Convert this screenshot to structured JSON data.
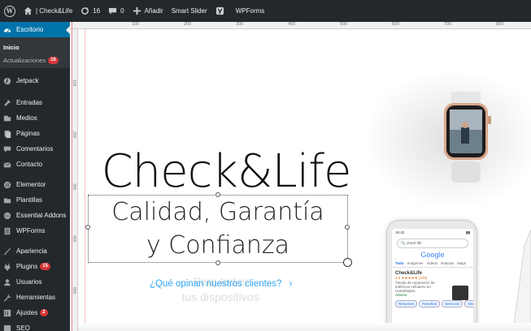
{
  "adminbar": {
    "site_name": "| Check&Life",
    "updates_count": "16",
    "comments_count": "0",
    "add_new": "Añadir",
    "smart_slider": "Smart Slider",
    "wpforms": "WPForms"
  },
  "sidebar": {
    "dashboard": "Escritorio",
    "sub_home": "Inicio",
    "sub_updates": "Actualizaciones",
    "sub_updates_badge": "16",
    "items": [
      {
        "label": "Jetpack",
        "icon": "jetpack-icon"
      },
      {
        "label": "Entradas",
        "icon": "pin-icon"
      },
      {
        "label": "Medios",
        "icon": "media-icon"
      },
      {
        "label": "Páginas",
        "icon": "pages-icon"
      },
      {
        "label": "Comentarios",
        "icon": "comment-icon"
      },
      {
        "label": "Contacto",
        "icon": "mail-icon"
      },
      {
        "label": "Elementor",
        "icon": "elementor-icon"
      },
      {
        "label": "Plantillas",
        "icon": "folder-icon"
      },
      {
        "label": "Essential Addons",
        "icon": "ea-icon"
      },
      {
        "label": "WPForms",
        "icon": "form-icon"
      },
      {
        "label": "Apariencia",
        "icon": "brush-icon"
      },
      {
        "label": "Plugins",
        "icon": "plugin-icon",
        "badge": "15"
      },
      {
        "label": "Usuarios",
        "icon": "user-icon"
      },
      {
        "label": "Herramientas",
        "icon": "wrench-icon"
      },
      {
        "label": "Ajustes",
        "icon": "settings-icon",
        "badge": "2"
      },
      {
        "label": "SEO",
        "icon": "seo-icon"
      }
    ]
  },
  "ruler": {
    "top": [
      "100",
      "200",
      "300",
      "400",
      "500",
      "600",
      "700",
      "800"
    ],
    "left": [
      "100",
      "200",
      "300",
      "400",
      "500"
    ]
  },
  "slide": {
    "headline": "Check&Life",
    "subtitle_line1": "Calidad, Garantía",
    "subtitle_line2": "y Confianza",
    "question": "¿Qué opinan nuestros clientes?",
    "ghost_line1": "Para todos",
    "ghost_line2": "tus dispositivos"
  },
  "phone": {
    "time": "16:42",
    "search": "check life",
    "brand": "Google",
    "tabs": [
      "Todo",
      "Imágenes",
      "Videos",
      "Noticias",
      "Maps"
    ],
    "result_title": "Check&Life",
    "result_rating": "4,9 ★★★★★ (105)",
    "result_desc": "Tienda de reparación de teléfonos celulares en Guadalajara",
    "result_status": "Abierto",
    "buttons": [
      "Resumen",
      "Reseñas",
      "Servicios",
      "Sitio"
    ]
  },
  "colors": {
    "adminbar": "#23282d",
    "accent": "#0073aa",
    "badge": "#d63638",
    "link": "#2ea3f2"
  }
}
